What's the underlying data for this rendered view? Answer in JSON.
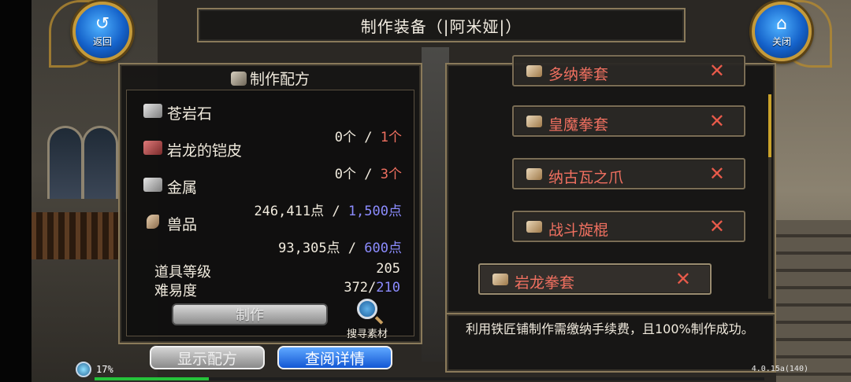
{
  "title": "制作装备（|阿米娅|）",
  "nav": {
    "back_label": "返回",
    "back_icon": "back-arrow-icon",
    "close_label": "关闭",
    "close_icon": "home-icon"
  },
  "recipe_panel": {
    "header": "制作配方",
    "materials": [
      {
        "name": "苍岩石",
        "have": "0个",
        "sep": " / ",
        "need": "1个",
        "need_color": "#f07060",
        "icon": "ore-icon"
      },
      {
        "name": "岩龙的铠皮",
        "have": "0个",
        "sep": " / ",
        "need": "3个",
        "need_color": "#f07060",
        "icon": "hide-icon"
      },
      {
        "name": "金属",
        "have": "246,411点",
        "sep": " / ",
        "need": "1,500点",
        "need_color": "#8c8cff",
        "icon": "metal-icon"
      },
      {
        "name": "兽品",
        "have": "93,305点",
        "sep": " / ",
        "need": "600点",
        "need_color": "#8c8cff",
        "icon": "claw-icon"
      }
    ],
    "item_level_label": "道具等级",
    "item_level_value": "205",
    "difficulty_label": "难易度",
    "difficulty_current": "372/",
    "difficulty_target": "210",
    "craft_label": "制作",
    "search_label": "搜寻素材"
  },
  "buttons": {
    "show_recipe": "显示配方",
    "view_details": "查阅详情"
  },
  "recipe_list": [
    {
      "name": "多纳拳套"
    },
    {
      "name": "皇魔拳套"
    },
    {
      "name": "纳古瓦之爪"
    },
    {
      "name": "战斗旋棍"
    },
    {
      "name": "岩龙拳套",
      "selected": true
    }
  ],
  "description": "利用铁匠铺制作需缴纳手续费，且100%制作成功。",
  "status": {
    "percent_text": "17%",
    "exp_fraction": 0.17,
    "version": "4.0.15a(140)"
  },
  "colors": {
    "accent_gold": "#c49a3a",
    "lacking_red": "#f07060",
    "points_blue": "#8c8cff",
    "exp_green": "#25c23a"
  }
}
